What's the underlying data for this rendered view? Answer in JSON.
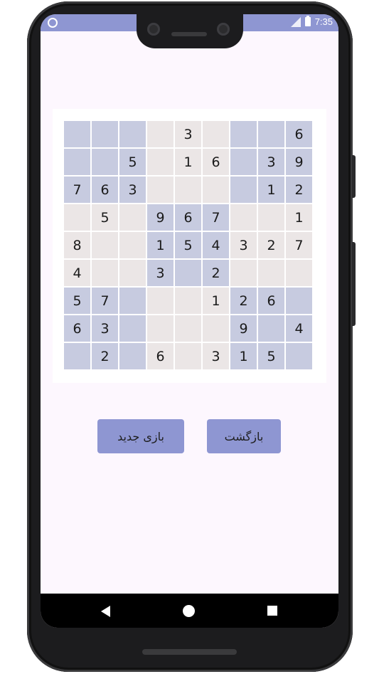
{
  "status_bar": {
    "time": "7:35",
    "icons": [
      "notification-circle-icon",
      "signal-icon",
      "battery-icon"
    ],
    "color": "#8e96d2"
  },
  "board": {
    "rows": [
      [
        "",
        "",
        "",
        "",
        "3",
        "",
        "",
        "",
        "6"
      ],
      [
        "",
        "",
        "5",
        "",
        "1",
        "6",
        "",
        "3",
        "9"
      ],
      [
        "7",
        "6",
        "3",
        "",
        "",
        "",
        "",
        "1",
        "2"
      ],
      [
        "",
        "5",
        "",
        "9",
        "6",
        "7",
        "",
        "",
        "1"
      ],
      [
        "8",
        "",
        "",
        "1",
        "5",
        "4",
        "3",
        "2",
        "7"
      ],
      [
        "4",
        "",
        "",
        "3",
        "",
        "2",
        "",
        "",
        ""
      ],
      [
        "5",
        "7",
        "",
        "",
        "",
        "1",
        "2",
        "6",
        ""
      ],
      [
        "6",
        "3",
        "",
        "",
        "",
        "",
        "9",
        "",
        "4"
      ],
      [
        "",
        "2",
        "",
        "6",
        "",
        "3",
        "1",
        "5",
        ""
      ]
    ],
    "shade_blue": "#c7cbe0",
    "shade_gray": "#ebe6e6"
  },
  "buttons": {
    "new_game_label": "بازی جدید",
    "back_label": "بازگشت",
    "color": "#8e96d2"
  },
  "nav": {
    "icons": [
      "back-triangle-icon",
      "home-circle-icon",
      "recents-square-icon"
    ]
  }
}
